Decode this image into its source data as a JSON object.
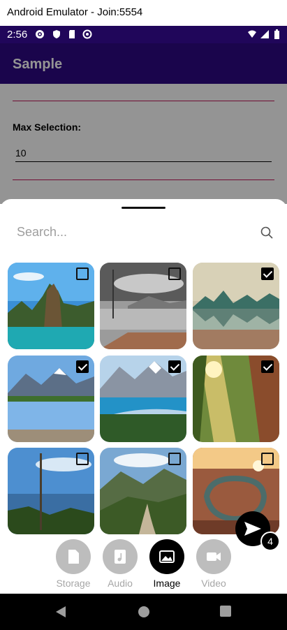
{
  "window": {
    "title": "Android Emulator - Join:5554"
  },
  "status_bar": {
    "time": "2:56"
  },
  "app_bar": {
    "title": "Sample"
  },
  "form": {
    "max_selection_label": "Max Selection:",
    "max_selection_value": "10"
  },
  "sheet": {
    "search_placeholder": "Search...",
    "images": [
      {
        "scene": "sea-stack",
        "checked": false
      },
      {
        "scene": "lake-dock",
        "checked": false
      },
      {
        "scene": "fjord-reflection",
        "checked": true
      },
      {
        "scene": "mountain-lake",
        "checked": true
      },
      {
        "scene": "turquoise-lake",
        "checked": true
      },
      {
        "scene": "forest-sunbeams",
        "checked": true
      },
      {
        "scene": "lake-pines",
        "checked": false
      },
      {
        "scene": "canyon-river",
        "checked": false
      },
      {
        "scene": "horseshoe-bend",
        "checked": false
      }
    ],
    "send_count": "4",
    "tabs": [
      {
        "label": "Storage",
        "icon": "file-icon",
        "active": false
      },
      {
        "label": "Audio",
        "icon": "music-file-icon",
        "active": false
      },
      {
        "label": "Image",
        "icon": "image-icon",
        "active": true
      },
      {
        "label": "Video",
        "icon": "video-camera-icon",
        "active": false
      }
    ]
  },
  "colors": {
    "status_bar": "#20065a",
    "app_bar": "#2d0983",
    "accent_line": "#c2185b",
    "active_tab": "#000000",
    "inactive_tab": "#bdbdbd"
  }
}
